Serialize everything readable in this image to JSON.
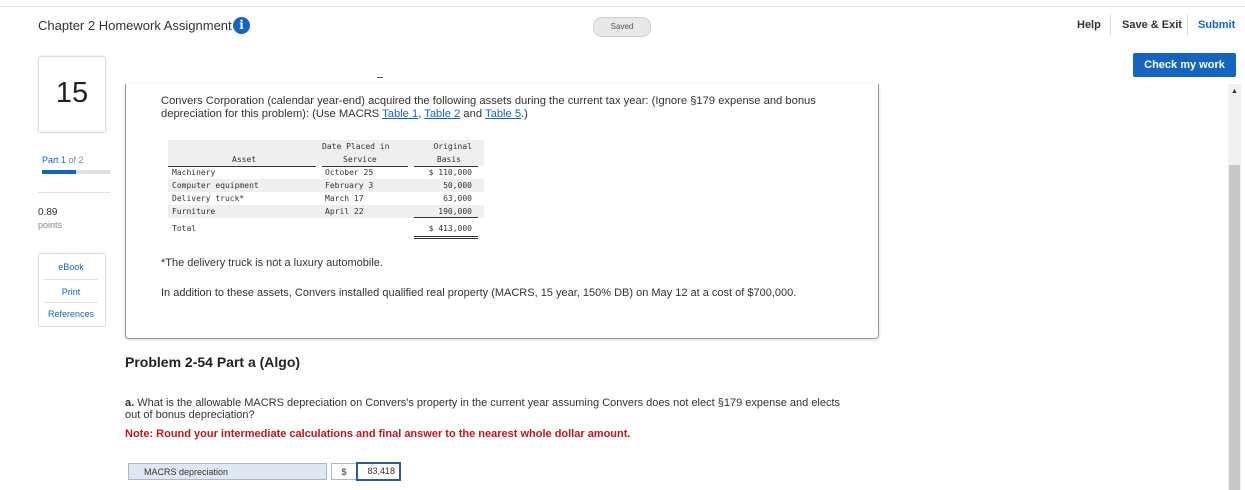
{
  "header": {
    "title": "Chapter 2 Homework Assignment",
    "info_icon": "info-icon",
    "saved": "Saved",
    "help": "Help",
    "save_exit": "Save & Exit",
    "submit": "Submit",
    "check_work": "Check my work"
  },
  "sidebar": {
    "question_number": "15",
    "part_label": "Part 1",
    "part_of": " of 2",
    "part_progress": 0.5,
    "points_value": "0.89",
    "points_label": "points",
    "links": [
      "eBook",
      "Print",
      "References"
    ]
  },
  "problem": {
    "intro_text": "Convers Corporation (calendar year-end) acquired the following assets during the current tax year: (Ignore §179 expense and bonus depreciation for this problem): (Use MACRS ",
    "link1": "Table 1",
    "sep1": ", ",
    "link2": "Table 2",
    "sep2": " and ",
    "link3": "Table 5",
    "intro_end": ".)",
    "table": {
      "headers": {
        "asset": "Asset",
        "date_line1": "Date Placed in",
        "date_line2": "Service",
        "basis_line1": "Original",
        "basis_line2": "Basis"
      },
      "rows": [
        {
          "asset": "Machinery",
          "date": "October 25",
          "basis": "$ 110,000"
        },
        {
          "asset": "Computer equipment",
          "date": "February 3",
          "basis": "50,000"
        },
        {
          "asset": "Delivery truck*",
          "date": "March 17",
          "basis": "63,000"
        },
        {
          "asset": "Furniture",
          "date": "April 22",
          "basis": "190,000"
        }
      ],
      "total": {
        "label": "Total",
        "basis": "$ 413,000"
      }
    },
    "footnote": "*The delivery truck is not a luxury automobile.",
    "addition": "In addition to these assets, Convers installed qualified real property (MACRS, 15 year, 150% DB) on May 12 at a cost of $700,000."
  },
  "part": {
    "title": "Problem 2-54 Part a (Algo)",
    "question_label": "a.",
    "question_text": " What is the allowable MACRS depreciation on Convers's property in the current year assuming Convers does not elect §179 expense and elects out of bonus depreciation?",
    "note": "Note: Round your intermediate calculations and final answer to the nearest whole dollar amount.",
    "answer_label": "MACRS depreciation",
    "answer_currency": "$",
    "answer_value": "83,418"
  },
  "colors": {
    "accent": "#1565c0",
    "note_red": "#c0161b"
  }
}
